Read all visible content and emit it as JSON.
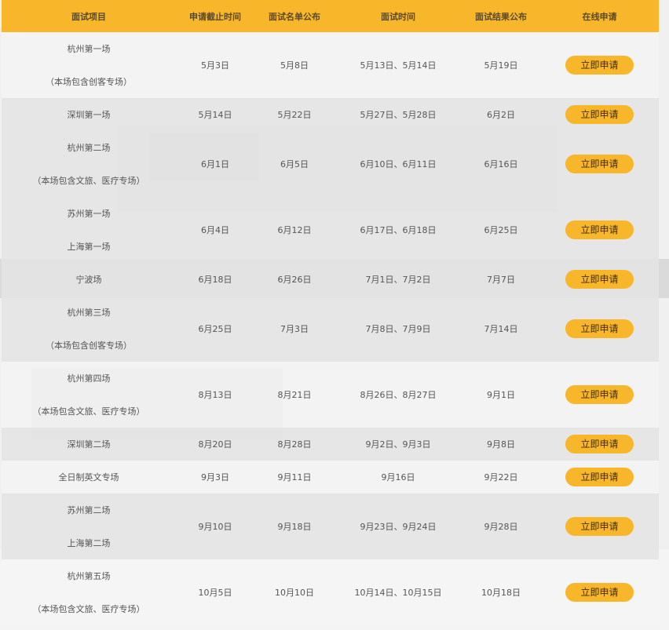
{
  "colors": {
    "accent": "#f8b62b",
    "shade": "#e4e4e4"
  },
  "header": {
    "project": "面试项目",
    "deadline": "申请截止时间",
    "list_publish": "面试名单公布",
    "interview_time": "面试时间",
    "result_publish": "面试结果公布",
    "apply_online": "在线申请"
  },
  "apply_label": "立即申请",
  "rows": [
    {
      "project": [
        "杭州第一场",
        "（本场包含创客专场）"
      ],
      "deadline": "5月3日",
      "list": "5月8日",
      "interview": "5月13日、5月14日",
      "result": "5月19日"
    },
    {
      "project": [
        "深圳第一场"
      ],
      "deadline": "5月14日",
      "list": "5月22日",
      "interview": "5月27日、5月28日",
      "result": "6月2日"
    },
    {
      "project": [
        "杭州第二场",
        "（本场包含文旅、医疗专场）"
      ],
      "deadline": "6月1日",
      "list": "6月5日",
      "interview": "6月10日、6月11日",
      "result": "6月16日"
    },
    {
      "project": [
        "苏州第一场",
        "上海第一场"
      ],
      "deadline": "6月4日",
      "list": "6月12日",
      "interview": "6月17日、6月18日",
      "result": "6月25日"
    },
    {
      "project": [
        "宁波场"
      ],
      "deadline": "6月18日",
      "list": "6月26日",
      "interview": "7月1日、7月2日",
      "result": "7月7日"
    },
    {
      "project": [
        "杭州第三场",
        "（本场包含创客专场）"
      ],
      "deadline": "6月25日",
      "list": "7月3日",
      "interview": "7月8日、7月9日",
      "result": "7月14日"
    },
    {
      "project": [
        "杭州第四场",
        "（本场包含文旅、医疗专场）"
      ],
      "deadline": "8月13日",
      "list": "8月21日",
      "interview": "8月26日、8月27日",
      "result": "9月1日"
    },
    {
      "project": [
        "深圳第二场"
      ],
      "deadline": "8月20日",
      "list": "8月28日",
      "interview": "9月2日、9月3日",
      "result": "9月8日"
    },
    {
      "project": [
        "全日制英文专场"
      ],
      "deadline": "9月3日",
      "list": "9月11日",
      "interview": "9月16日",
      "result": "9月22日"
    },
    {
      "project": [
        "苏州第二场",
        "上海第二场"
      ],
      "deadline": "9月10日",
      "list": "9月18日",
      "interview": "9月23日、9月24日",
      "result": "9月28日"
    },
    {
      "project": [
        "杭州第五场",
        "（本场包含文旅、医疗专场）"
      ],
      "deadline": "10月5日",
      "list": "10月10日",
      "interview": "10月14日、10月15日",
      "result": "10月18日"
    }
  ]
}
